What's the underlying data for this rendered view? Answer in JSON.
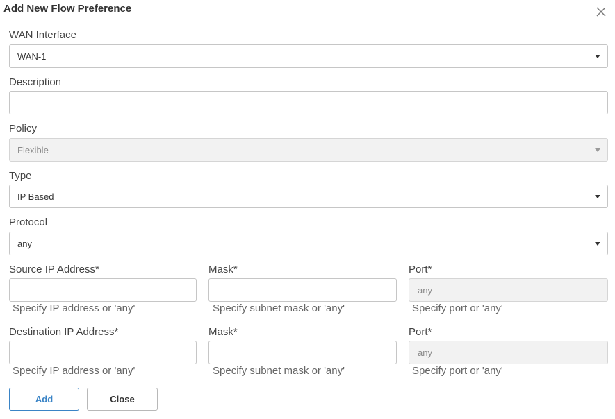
{
  "dialog": {
    "title": "Add New Flow Preference"
  },
  "wan_interface": {
    "label": "WAN Interface",
    "value": "WAN-1"
  },
  "description": {
    "label": "Description",
    "value": ""
  },
  "policy": {
    "label": "Policy",
    "value": "Flexible"
  },
  "type": {
    "label": "Type",
    "value": "IP Based"
  },
  "protocol": {
    "label": "Protocol",
    "value": "any"
  },
  "source": {
    "ip_label": "Source IP Address*",
    "ip_hint": "Specify IP address or 'any'",
    "mask_label": "Mask*",
    "mask_hint": "Specify subnet mask or 'any'",
    "port_label": "Port*",
    "port_placeholder": "any",
    "port_hint": "Specify port or 'any'"
  },
  "destination": {
    "ip_label": "Destination IP Address*",
    "ip_hint": "Specify IP address or 'any'",
    "mask_label": "Mask*",
    "mask_hint": "Specify subnet mask or 'any'",
    "port_label": "Port*",
    "port_placeholder": "any",
    "port_hint": "Specify port or 'any'"
  },
  "buttons": {
    "add_label": "Add",
    "close_label": "Close"
  },
  "colors": {
    "primary": "#3a84c6",
    "border": "#c6c6c6",
    "disabled_bg": "#f2f2f2"
  },
  "icons": {
    "close": "close-icon",
    "dropdown": "chevron-down-icon"
  }
}
